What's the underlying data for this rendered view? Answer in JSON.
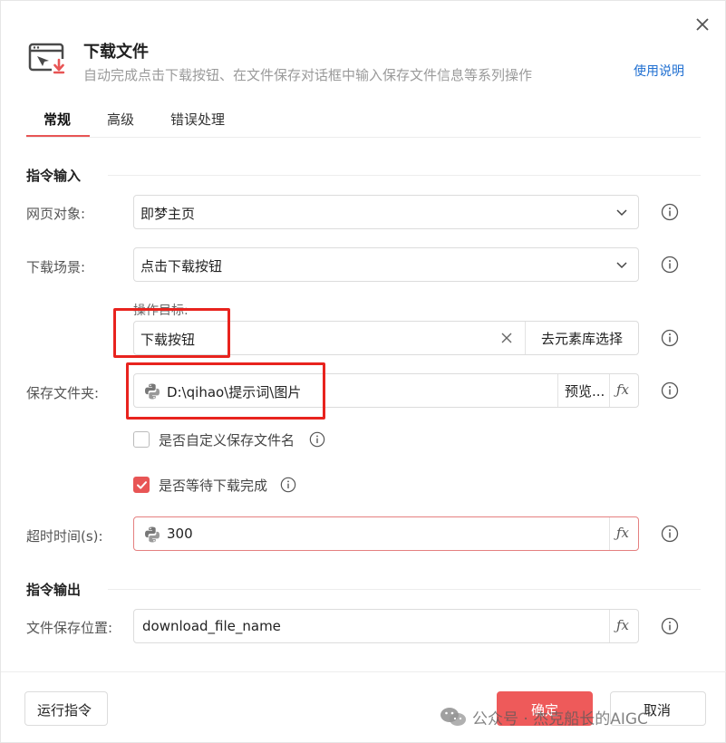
{
  "dialog": {
    "title": "下载文件",
    "subtitle": "自动完成点击下载按钮、在文件保存对话框中输入保存文件信息等系列操作",
    "help_link": "使用说明"
  },
  "tabs": [
    {
      "label": "常规",
      "active": true
    },
    {
      "label": "高级",
      "active": false
    },
    {
      "label": "错误处理",
      "active": false
    }
  ],
  "input_section": {
    "title": "指令输入",
    "web_object": {
      "label": "网页对象:",
      "value": "即梦主页"
    },
    "download_scene": {
      "label": "下载场景:",
      "value": "点击下载按钮"
    },
    "target": {
      "caption": "操作目标:",
      "value": "下载按钮",
      "library_button": "去元素库选择"
    },
    "save_folder": {
      "label": "保存文件夹:",
      "value": "D:\\qihao\\提示词\\图片",
      "preview_button": "预览..."
    },
    "custom_filename": {
      "label": "是否自定义保存文件名",
      "checked": false
    },
    "wait_download": {
      "label": "是否等待下载完成",
      "checked": true
    },
    "timeout": {
      "label": "超时时间(s):",
      "value": "300"
    }
  },
  "output_section": {
    "title": "指令输出",
    "save_location": {
      "label": "文件保存位置:",
      "value": "download_file_name"
    }
  },
  "footer": {
    "run_button": "运行指令",
    "ok_button": "确定",
    "cancel_button": "取消"
  },
  "fx_label": "ƒx",
  "watermark": "公众号 · 杰克船长的AIGC",
  "colors": {
    "accent": "#e85555",
    "link": "#1f6fd1",
    "highlight_box": "#e8231e",
    "error_border": "#e58080"
  },
  "icons": [
    "download-file-icon",
    "close-icon",
    "chevron-down-icon",
    "info-icon",
    "python-icon",
    "clear-icon",
    "check-icon",
    "wechat-icon"
  ]
}
